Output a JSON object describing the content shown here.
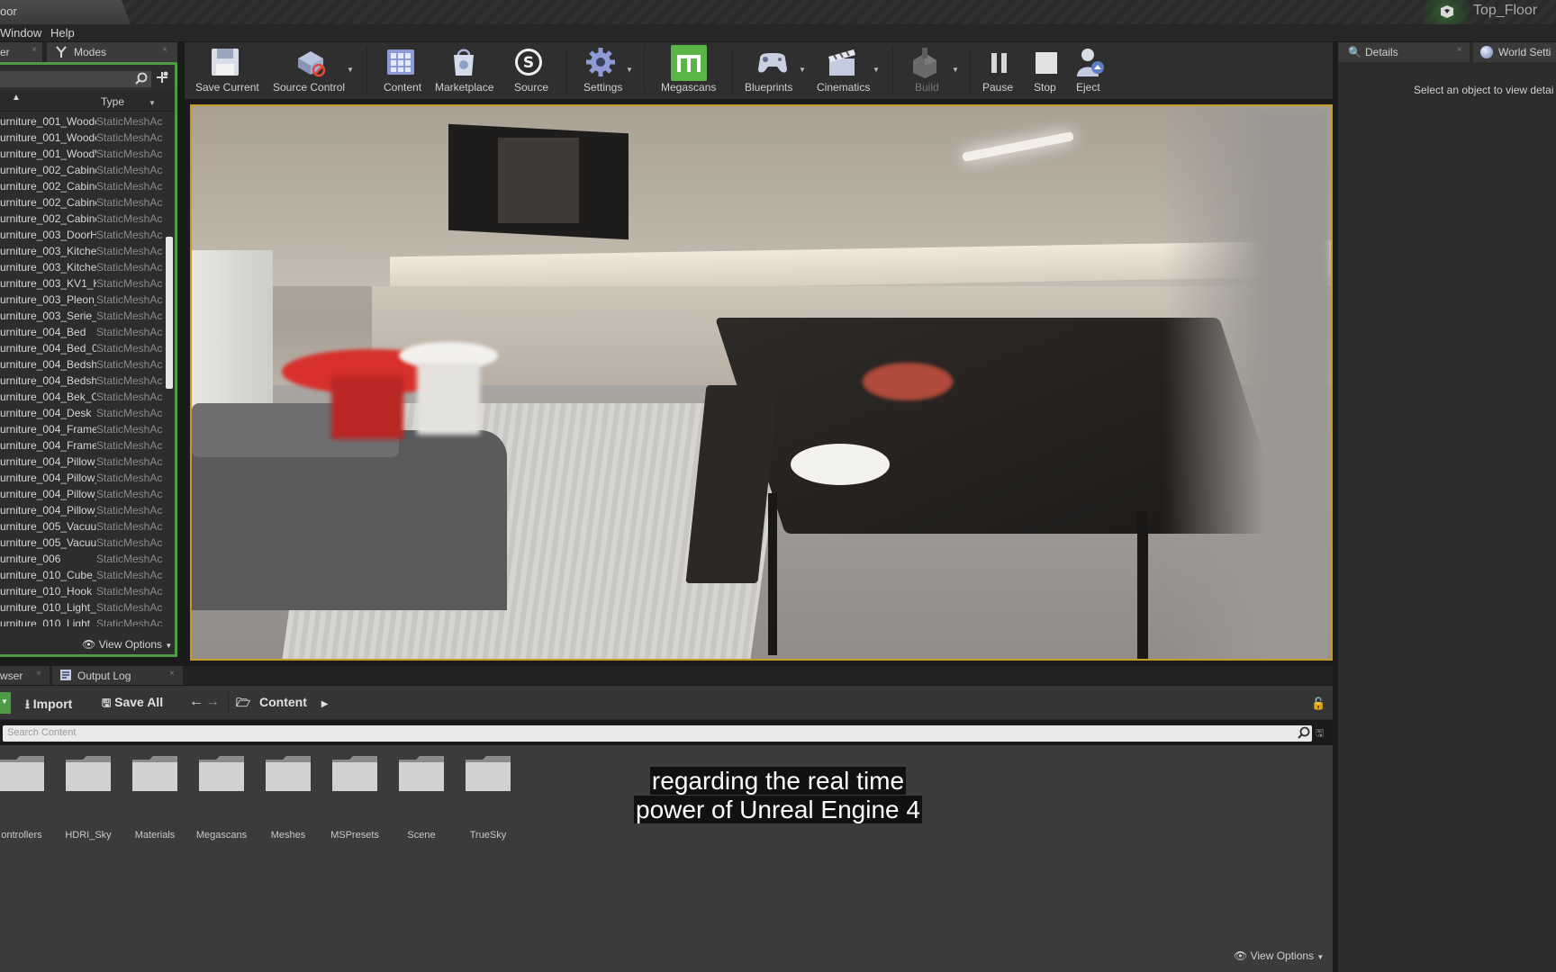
{
  "titlebar": {
    "doc_tab": "oor",
    "project_name": "Top_Floor"
  },
  "menubar": {
    "items": [
      "Window",
      "Help"
    ]
  },
  "left_panel": {
    "tabs": [
      "er",
      "Modes"
    ],
    "column_type": "Type",
    "rows": [
      {
        "name": "urniture_001_Woode",
        "type": "StaticMeshAc"
      },
      {
        "name": "urniture_001_Woode",
        "type": "StaticMeshAc"
      },
      {
        "name": "urniture_001_WoodW",
        "type": "StaticMeshAc"
      },
      {
        "name": "urniture_002_Cabine",
        "type": "StaticMeshAc"
      },
      {
        "name": "urniture_002_Cabine",
        "type": "StaticMeshAc"
      },
      {
        "name": "urniture_002_Cabine",
        "type": "StaticMeshAc"
      },
      {
        "name": "urniture_002_Cabine",
        "type": "StaticMeshAc"
      },
      {
        "name": "urniture_003_DoorH",
        "type": "StaticMeshAc"
      },
      {
        "name": "urniture_003_Kitcher",
        "type": "StaticMeshAc"
      },
      {
        "name": "urniture_003_Kitcher",
        "type": "StaticMeshAc"
      },
      {
        "name": "urniture_003_KV1_K",
        "type": "StaticMeshAc"
      },
      {
        "name": "urniture_003_Pleon_",
        "type": "StaticMeshAc"
      },
      {
        "name": "urniture_003_Serie_",
        "type": "StaticMeshAc"
      },
      {
        "name": "urniture_004_Bed",
        "type": "StaticMeshAc"
      },
      {
        "name": "urniture_004_Bed_0",
        "type": "StaticMeshAc"
      },
      {
        "name": "urniture_004_Bedsh",
        "type": "StaticMeshAc"
      },
      {
        "name": "urniture_004_Bedsh",
        "type": "StaticMeshAc"
      },
      {
        "name": "urniture_004_Bek_Cl",
        "type": "StaticMeshAc"
      },
      {
        "name": "urniture_004_Desk",
        "type": "StaticMeshAc"
      },
      {
        "name": "urniture_004_Frame_",
        "type": "StaticMeshAc"
      },
      {
        "name": "urniture_004_Frame_",
        "type": "StaticMeshAc"
      },
      {
        "name": "urniture_004_Pillow_",
        "type": "StaticMeshAc"
      },
      {
        "name": "urniture_004_Pillow_",
        "type": "StaticMeshAc"
      },
      {
        "name": "urniture_004_Pillow_",
        "type": "StaticMeshAc"
      },
      {
        "name": "urniture_004_Pillow_",
        "type": "StaticMeshAc"
      },
      {
        "name": "urniture_005_Vacuu",
        "type": "StaticMeshAc"
      },
      {
        "name": "urniture_005_Vacuu",
        "type": "StaticMeshAc"
      },
      {
        "name": "urniture_006",
        "type": "StaticMeshAc"
      },
      {
        "name": "urniture_010_Cube_",
        "type": "StaticMeshAc"
      },
      {
        "name": "urniture_010_Hook",
        "type": "StaticMeshAc"
      },
      {
        "name": "urniture_010_Light_",
        "type": "StaticMeshAc"
      },
      {
        "name": "urniture_010_Light_",
        "type": "StaticMeshAc"
      }
    ],
    "view_options": "View Options"
  },
  "toolbar": {
    "save_current": "Save Current",
    "source_control": "Source Control",
    "content": "Content",
    "marketplace": "Marketplace",
    "source": "Source",
    "settings": "Settings",
    "megascans": "Megascans",
    "blueprints": "Blueprints",
    "cinematics": "Cinematics",
    "build": "Build",
    "pause": "Pause",
    "stop": "Stop",
    "eject": "Eject"
  },
  "bottom": {
    "tabs": [
      "wser",
      "Output Log"
    ],
    "import": "Import",
    "save_all": "Save All",
    "path": "Content",
    "search_placeholder": "Search Content",
    "folders": [
      "ontrollers",
      "HDRI_Sky",
      "Materials",
      "Megascans",
      "Meshes",
      "MSPresets",
      "Scene",
      "TrueSky"
    ],
    "subtitle_line1": "regarding the real time",
    "subtitle_line2": "power of Unreal Engine 4",
    "view_options": "View Options"
  },
  "right_panel": {
    "tabs": [
      "Details",
      "World Setti"
    ],
    "empty_message": "Select an object to view detai"
  },
  "colors": {
    "selection_green": "#4f9a45",
    "viewport_border": "#c49a2a",
    "megascans_green": "#5bb546"
  }
}
